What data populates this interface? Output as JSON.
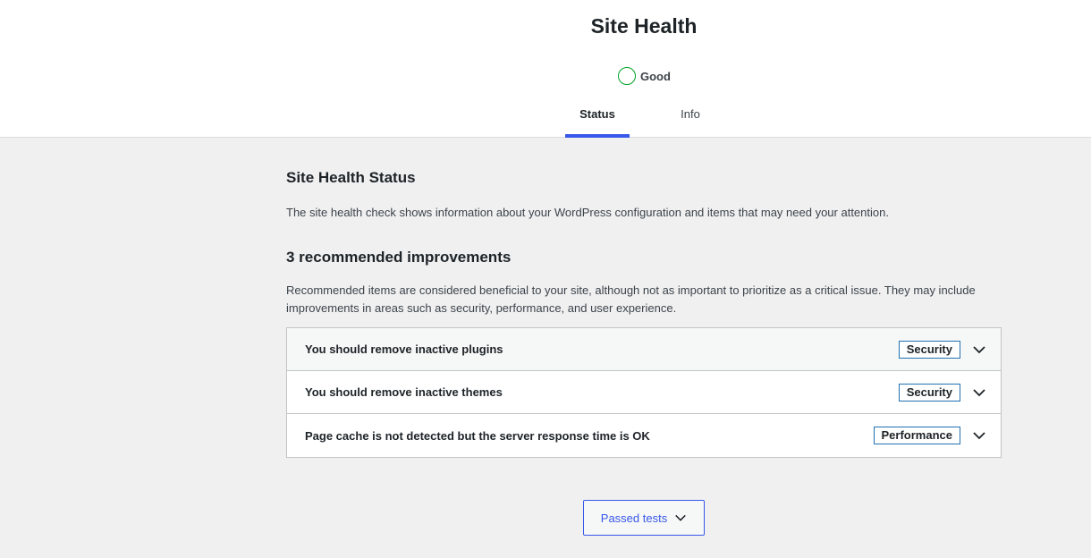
{
  "header": {
    "title": "Site Health",
    "status_label": "Good",
    "status_color": "#00a32a",
    "tabs": [
      {
        "label": "Status",
        "active": true
      },
      {
        "label": "Info",
        "active": false
      }
    ],
    "accent_color": "#3858e9"
  },
  "main": {
    "section_title": "Site Health Status",
    "description": "The site health check shows information about your WordPress configuration and items that may need your attention.",
    "recommended_title": "3 recommended improvements",
    "recommended_description": "Recommended items are considered beneficial to your site, although not as important to prioritize as a critical issue. They may include improvements in areas such as security, performance, and user experience.",
    "items": [
      {
        "title": "You should remove inactive plugins",
        "badge": "Security",
        "icon": "chevron-down-icon"
      },
      {
        "title": "You should remove inactive themes",
        "badge": "Security",
        "icon": "chevron-down-icon"
      },
      {
        "title": "Page cache is not detected but the server response time is OK",
        "badge": "Performance",
        "icon": "chevron-down-icon"
      }
    ],
    "passed_tests_label": "Passed tests"
  }
}
